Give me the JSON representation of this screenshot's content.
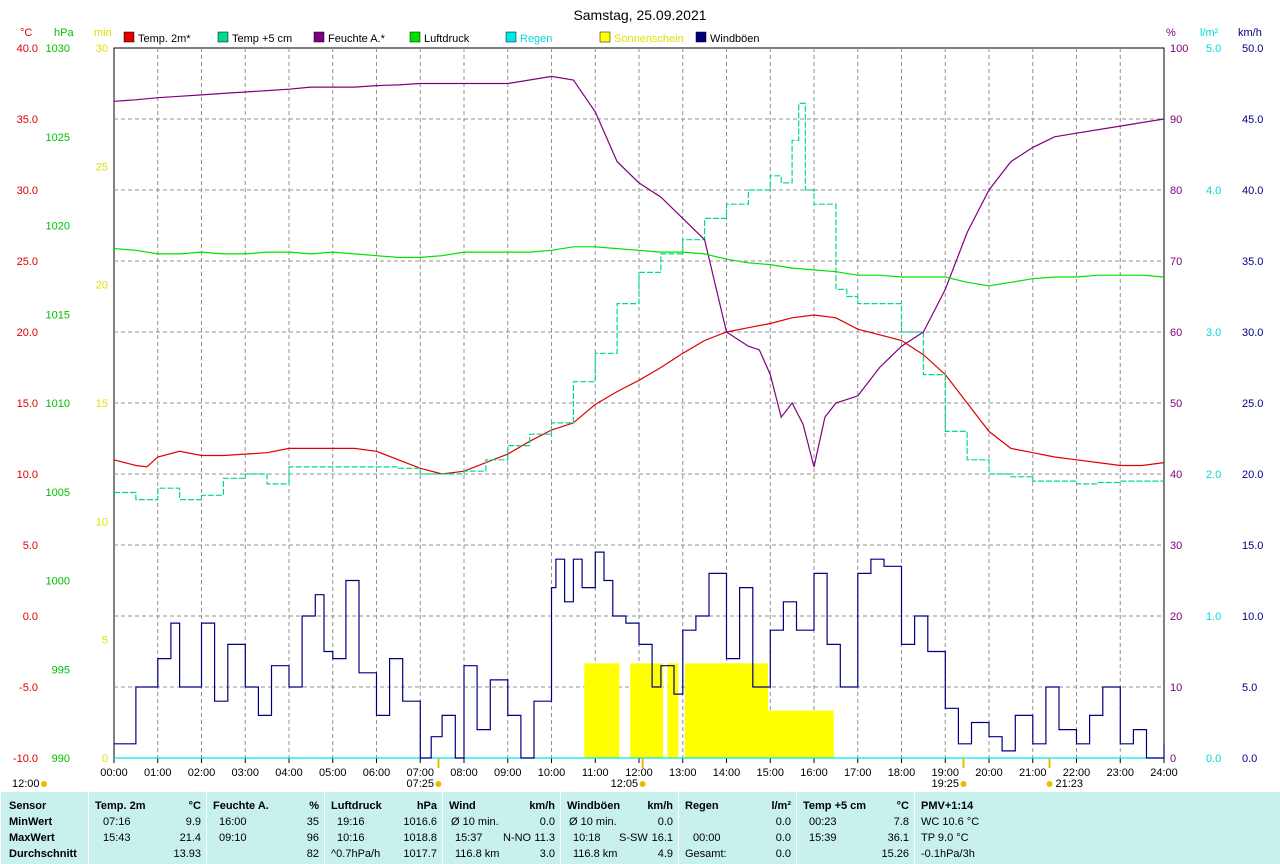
{
  "title": "Samstag, 25.09.2021",
  "legend": [
    {
      "label": "Temp. 2m*",
      "color": "#e00000"
    },
    {
      "label": "Temp +5 cm",
      "color": "#00d890"
    },
    {
      "label": "Feuchte A.*",
      "color": "#800080"
    },
    {
      "label": "Luftdruck",
      "color": "#00e000"
    },
    {
      "label": "Regen",
      "color": "#00e8e8"
    },
    {
      "label": "Sonnenschein",
      "color": "#ffff00"
    },
    {
      "label": "Windböen",
      "color": "#000080"
    }
  ],
  "axes": {
    "temp": {
      "unit": "°C",
      "color": "#e00000",
      "ticks": [
        "40.0",
        "35.0",
        "30.0",
        "25.0",
        "20.0",
        "15.0",
        "10.0",
        "5.0",
        "0.0",
        "-5.0",
        "-10.0"
      ]
    },
    "pressure": {
      "unit": "hPa",
      "color": "#00c000",
      "ticks": [
        "1030",
        "1025",
        "1020",
        "1015",
        "1010",
        "1005",
        "1000",
        "995",
        "990"
      ]
    },
    "sun": {
      "unit": "min",
      "color": "#e0e000",
      "ticks": [
        "30",
        "25",
        "20",
        "15",
        "10",
        "5",
        "0"
      ]
    },
    "humidity": {
      "unit": "%",
      "color": "#800080",
      "ticks": [
        "100",
        "90",
        "80",
        "70",
        "60",
        "50",
        "40",
        "30",
        "20",
        "10",
        "0"
      ]
    },
    "rain": {
      "unit": "l/m²",
      "color": "#00d8d8",
      "ticks": [
        "5.0",
        "4.0",
        "3.0",
        "2.0",
        "1.0",
        "0.0"
      ]
    },
    "wind": {
      "unit": "km/h",
      "color": "#000080",
      "ticks": [
        "50.0",
        "45.0",
        "40.0",
        "35.0",
        "30.0",
        "25.0",
        "20.0",
        "15.0",
        "10.0",
        "5.0",
        "0.0"
      ]
    },
    "x_ticks": [
      "00:00",
      "01:00",
      "02:00",
      "03:00",
      "04:00",
      "05:00",
      "06:00",
      "07:00",
      "08:00",
      "09:00",
      "10:00",
      "11:00",
      "12:00",
      "13:00",
      "14:00",
      "15:00",
      "16:00",
      "17:00",
      "18:00",
      "19:00",
      "20:00",
      "21:00",
      "22:00",
      "23:00",
      "24:00"
    ]
  },
  "markers": {
    "noon_left": "12:00",
    "sunrise": "07:25",
    "solar_noon": "12:05",
    "sunset": "19:25",
    "moonrise": "21:23"
  },
  "chart_data": {
    "type": "line",
    "x_unit": "hour",
    "xlim": [
      0,
      24
    ],
    "series": [
      {
        "name": "Temp. 2m*",
        "axis": "temp",
        "color": "#e00000",
        "x": [
          0,
          0.5,
          0.75,
          1,
          1.5,
          2,
          2.5,
          3,
          3.5,
          4,
          4.5,
          5,
          5.5,
          6,
          6.5,
          7,
          7.5,
          8,
          8.5,
          9,
          9.5,
          10,
          10.5,
          11,
          11.5,
          12,
          12.5,
          13,
          13.5,
          14,
          14.5,
          15,
          15.5,
          16,
          16.5,
          17,
          17.5,
          18,
          18.5,
          19,
          19.5,
          20,
          20.5,
          21,
          21.5,
          22,
          22.5,
          23,
          23.5,
          24
        ],
        "y": [
          11.0,
          10.6,
          10.5,
          11.2,
          11.6,
          11.3,
          11.3,
          11.4,
          11.5,
          11.8,
          11.8,
          11.8,
          11.8,
          11.6,
          11.0,
          10.4,
          10.0,
          10.2,
          10.8,
          11.4,
          12.3,
          13.1,
          13.6,
          14.9,
          15.8,
          16.6,
          17.5,
          18.5,
          19.4,
          20.0,
          20.3,
          20.6,
          21.0,
          21.2,
          21.0,
          20.2,
          19.8,
          19.4,
          18.4,
          17.0,
          15.0,
          13.0,
          11.8,
          11.5,
          11.2,
          11.0,
          10.8,
          10.6,
          10.6,
          10.8
        ]
      },
      {
        "name": "Temp +5 cm",
        "axis": "temp",
        "color": "#00d890",
        "x": [
          0,
          0.5,
          1,
          1.5,
          2,
          2.5,
          3,
          3.5,
          4,
          4.5,
          5,
          5.5,
          6,
          6.5,
          7,
          7.5,
          8,
          8.5,
          9,
          9.5,
          10,
          10.5,
          11,
          11.5,
          12,
          12.5,
          13,
          13.5,
          14,
          14.5,
          15,
          15.25,
          15.5,
          15.65,
          15.8,
          16,
          16.5,
          16.75,
          17,
          17.5,
          18,
          18.5,
          19,
          19.5,
          20,
          20.5,
          21,
          21.5,
          22,
          22.5,
          23,
          23.5,
          24
        ],
        "y": [
          8.7,
          8.2,
          9.0,
          8.2,
          8.5,
          9.7,
          10.0,
          9.3,
          10.5,
          10.5,
          10.5,
          10.5,
          10.5,
          10.4,
          10.0,
          10.0,
          10.2,
          11.0,
          12.0,
          12.8,
          13.6,
          16.5,
          18.5,
          22.0,
          24.2,
          25.5,
          26.5,
          28.0,
          29.0,
          30.0,
          31.0,
          30.5,
          33.5,
          36.1,
          30.0,
          29.0,
          23.0,
          22.5,
          22.0,
          22.0,
          20.0,
          17.0,
          13.0,
          11.0,
          10.0,
          9.8,
          9.5,
          9.5,
          9.3,
          9.4,
          9.5,
          9.5,
          9.5
        ]
      },
      {
        "name": "Feuchte A.*",
        "axis": "humidity",
        "color": "#800080",
        "x": [
          0,
          0.5,
          1,
          1.5,
          2,
          2.5,
          3,
          3.5,
          4,
          4.5,
          5,
          5.5,
          6,
          6.5,
          7,
          7.5,
          8,
          8.5,
          9,
          9.5,
          10,
          10.5,
          11,
          11.5,
          12,
          12.5,
          13,
          13.5,
          14,
          14.25,
          14.5,
          14.75,
          15,
          15.25,
          15.5,
          15.75,
          16,
          16.25,
          16.5,
          17,
          17.5,
          18,
          18.5,
          19,
          19.5,
          20,
          20.5,
          21,
          21.5,
          22,
          22.5,
          23,
          23.5,
          24
        ],
        "y": [
          92.5,
          92.7,
          93.0,
          93.2,
          93.4,
          93.6,
          93.8,
          94.0,
          94.2,
          94.5,
          94.5,
          94.5,
          94.7,
          94.8,
          95.0,
          95.0,
          95.0,
          95.0,
          95.0,
          95.5,
          96.0,
          95.5,
          91.0,
          84.0,
          81.0,
          79.0,
          76.0,
          73.0,
          60.0,
          59.0,
          58.0,
          57.5,
          54.0,
          48.0,
          50.0,
          47.0,
          41.0,
          48.0,
          50.0,
          51.0,
          55.0,
          58.0,
          60.0,
          66.0,
          74.0,
          80.0,
          84.0,
          86.0,
          87.5,
          88.0,
          88.5,
          89.0,
          89.5,
          90.0
        ]
      },
      {
        "name": "Luftdruck",
        "axis": "pressure",
        "color": "#00e000",
        "x": [
          0,
          0.5,
          1,
          1.5,
          2,
          2.5,
          3,
          3.5,
          4,
          4.5,
          5,
          5.5,
          6,
          6.5,
          7,
          7.5,
          8,
          8.5,
          9,
          9.5,
          10,
          10.5,
          11,
          11.5,
          12,
          12.5,
          13,
          13.5,
          14,
          14.5,
          15,
          15.5,
          16,
          16.5,
          17,
          17.5,
          18,
          18.5,
          19,
          19.5,
          20,
          20.5,
          21,
          21.5,
          22,
          22.5,
          23,
          23.5,
          24
        ],
        "y": [
          1018.7,
          1018.6,
          1018.4,
          1018.4,
          1018.5,
          1018.4,
          1018.4,
          1018.5,
          1018.5,
          1018.4,
          1018.5,
          1018.4,
          1018.3,
          1018.2,
          1018.2,
          1018.3,
          1018.5,
          1018.5,
          1018.5,
          1018.5,
          1018.6,
          1018.8,
          1018.8,
          1018.7,
          1018.6,
          1018.5,
          1018.5,
          1018.4,
          1018.1,
          1017.9,
          1017.8,
          1017.6,
          1017.5,
          1017.4,
          1017.2,
          1017.2,
          1017.1,
          1017.1,
          1017.1,
          1016.8,
          1016.6,
          1016.8,
          1017.0,
          1017.1,
          1017.1,
          1017.2,
          1017.2,
          1017.2,
          1017.1
        ]
      },
      {
        "name": "Regen",
        "axis": "rain",
        "color": "#00e8e8",
        "x": [
          0,
          24
        ],
        "y": [
          0,
          0
        ]
      },
      {
        "name": "Windböen",
        "axis": "wind",
        "color": "#000080",
        "x": [
          0,
          0.5,
          1,
          1.3,
          1.5,
          2,
          2.3,
          2.6,
          3,
          3.3,
          3.6,
          4,
          4.3,
          4.6,
          4.8,
          5,
          5.3,
          5.6,
          6,
          6.3,
          6.6,
          7,
          7.25,
          7.5,
          7.8,
          8,
          8.3,
          8.6,
          9,
          9.3,
          9.6,
          10,
          10.1,
          10.3,
          10.5,
          10.7,
          11,
          11.2,
          11.4,
          11.7,
          12,
          12.3,
          12.5,
          12.8,
          13,
          13.3,
          13.6,
          14,
          14.3,
          14.6,
          15,
          15.3,
          15.6,
          16,
          16.3,
          16.6,
          17,
          17.3,
          17.6,
          18,
          18.3,
          18.6,
          19,
          19.3,
          19.6,
          20,
          20.3,
          20.6,
          21,
          21.3,
          21.6,
          22,
          22.3,
          22.6,
          23,
          23.3,
          23.6,
          24
        ],
        "y": [
          1.0,
          5.0,
          7.0,
          9.5,
          5.0,
          9.5,
          4.0,
          8.0,
          5.0,
          3.0,
          6.5,
          5.0,
          10.0,
          11.5,
          7.5,
          7.0,
          12.5,
          6.0,
          3.0,
          7.0,
          4.0,
          0.0,
          1.5,
          3.0,
          0.0,
          6.5,
          2.0,
          5.5,
          3.0,
          0.0,
          4.0,
          12.0,
          14.0,
          11.0,
          14.0,
          12.0,
          14.5,
          12.5,
          10.0,
          9.5,
          8.0,
          5.0,
          6.5,
          4.5,
          9.0,
          10.0,
          13.0,
          7.0,
          12.0,
          5.0,
          9.0,
          11.0,
          9.0,
          13.0,
          8.0,
          5.0,
          13.0,
          14.0,
          13.5,
          8.0,
          10.0,
          7.5,
          3.5,
          1.0,
          2.5,
          1.5,
          0.5,
          3.0,
          1.0,
          5.0,
          2.0,
          1.0,
          3.0,
          5.0,
          1.0,
          2.0,
          0.0,
          1.0
        ]
      },
      {
        "name": "Sonnenschein",
        "axis": "sun",
        "color": "#ffff00",
        "type": "bar",
        "intervals": [
          {
            "start": 10.75,
            "end": 11.55,
            "value": 4.0
          },
          {
            "start": 11.8,
            "end": 12.55,
            "value": 4.0
          },
          {
            "start": 12.65,
            "end": 12.9,
            "value": 4.0
          },
          {
            "start": 13.05,
            "end": 14.95,
            "value": 4.0
          },
          {
            "start": 14.95,
            "end": 16.45,
            "value": 2.0
          }
        ]
      }
    ]
  },
  "stats": {
    "headers": [
      "Sensor",
      "Temp. 2m",
      "°C",
      "Feuchte A.",
      "%",
      "Luftdruck",
      "hPa",
      "Wind",
      "km/h",
      "Windböen",
      "km/h",
      "Regen",
      "l/m²",
      "Temp +5 cm",
      "°C",
      "PMV+1:14"
    ],
    "row_labels": [
      "MinWert",
      "MaxWert",
      "Durchschnitt"
    ],
    "temp2m": [
      [
        "07:16",
        "9.9"
      ],
      [
        "15:43",
        "21.4"
      ],
      [
        "",
        "13.93"
      ]
    ],
    "feuchte": [
      [
        "16:00",
        "35"
      ],
      [
        "09:10",
        "96"
      ],
      [
        "",
        "82"
      ]
    ],
    "luftdruck": [
      [
        "19:16",
        "1016.6"
      ],
      [
        "10:16",
        "1018.8"
      ],
      [
        "^0.7hPa/h",
        "1017.7"
      ]
    ],
    "wind": [
      [
        "Ø 10 min.",
        "",
        "0.0"
      ],
      [
        "15:37",
        "N-NO",
        "11.3"
      ],
      [
        "116.8 km",
        "",
        "3.0"
      ]
    ],
    "windboeen": [
      [
        "Ø 10 min.",
        "",
        "0.0"
      ],
      [
        "10:18",
        "S-SW",
        "16.1"
      ],
      [
        "116.8 km",
        "",
        "4.9"
      ]
    ],
    "regen": [
      [
        "",
        ""
      ],
      [
        "00:00",
        "0.0"
      ],
      [
        "Gesamt:",
        "0.0"
      ]
    ],
    "temp5cm": [
      [
        "00:23",
        "7.8"
      ],
      [
        "15:39",
        "36.1"
      ],
      [
        "",
        "15.26"
      ]
    ],
    "pmv": [
      "WC 10.6 °C",
      "TP 9.0 °C",
      "-0.1hPa/3h"
    ],
    "regen_min": "0.0"
  }
}
